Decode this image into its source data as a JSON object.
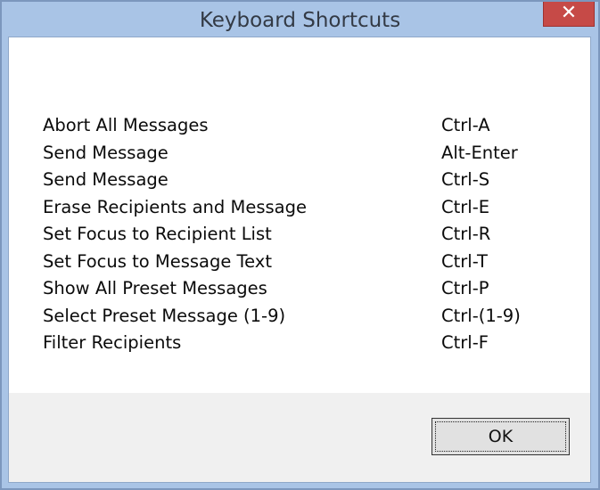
{
  "window": {
    "title": "Keyboard Shortcuts",
    "close_glyph": "✕",
    "close_icon": "close-icon"
  },
  "shortcuts": [
    {
      "action": "Abort All Messages",
      "keys": "Ctrl-A"
    },
    {
      "action": "Send Message",
      "keys": "Alt-Enter"
    },
    {
      "action": "Send Message",
      "keys": "Ctrl-S"
    },
    {
      "action": "Erase Recipients and Message",
      "keys": "Ctrl-E"
    },
    {
      "action": "Set Focus to Recipient List",
      "keys": "Ctrl-R"
    },
    {
      "action": "Set Focus to Message Text",
      "keys": "Ctrl-T"
    },
    {
      "action": "Show All Preset Messages",
      "keys": "Ctrl-P"
    },
    {
      "action": "Select Preset Message (1-9)",
      "keys": "Ctrl-(1-9)"
    },
    {
      "action": "Filter Recipients",
      "keys": "Ctrl-F"
    }
  ],
  "buttons": {
    "ok_label": "OK"
  },
  "colors": {
    "frame": "#a9c4e6",
    "close_button": "#c64a47",
    "content_background": "#ffffff",
    "button_area": "#f0f0f0"
  }
}
